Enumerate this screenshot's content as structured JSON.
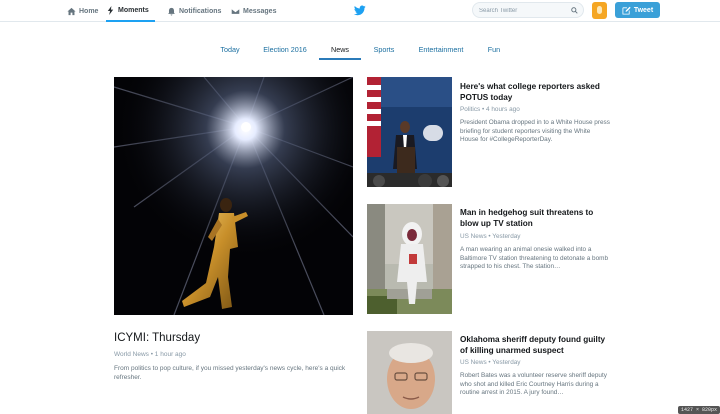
{
  "nav": {
    "home": "Home",
    "moments": "Moments",
    "notifications": "Notifications",
    "messages": "Messages"
  },
  "search": {
    "placeholder": "Search Twitter"
  },
  "tweet_button": "Tweet",
  "tabs": [
    "Today",
    "Election 2016",
    "News",
    "Sports",
    "Entertainment",
    "Fun"
  ],
  "active_tab": "News",
  "lead": {
    "title": "ICYMI: Thursday",
    "meta": "World News • 1 hour ago",
    "description": "From politics to pop culture, if you missed yesterday's news cycle, here's a quick refresher."
  },
  "stories": [
    {
      "title": "Here's what college reporters asked POTUS today",
      "meta": "Politics • 4 hours ago",
      "description": "President Obama dropped in to a White House press briefing for student reporters visiting the White House for #CollegeReporterDay."
    },
    {
      "title": "Man in hedgehog suit threatens to blow up TV station",
      "meta": "US News • Yesterday",
      "description": "A man wearing an animal onesie walked into a Baltimore TV station threatening to detonate a bomb strapped to his chest. The station…"
    },
    {
      "title": "Oklahoma sheriff deputy found guilty of killing unarmed suspect",
      "meta": "US News • Yesterday",
      "description": "Robert Bates was a volunteer reserve sheriff deputy who shot and killed Eric Courtney Harris during a routine arrest in 2015. A jury found…"
    }
  ],
  "screen_size_badge": "1427 × 820px",
  "colors": {
    "accent": "#1da1f2",
    "tweet_button": "#3aa0d8",
    "link": "#1b6fa0"
  }
}
